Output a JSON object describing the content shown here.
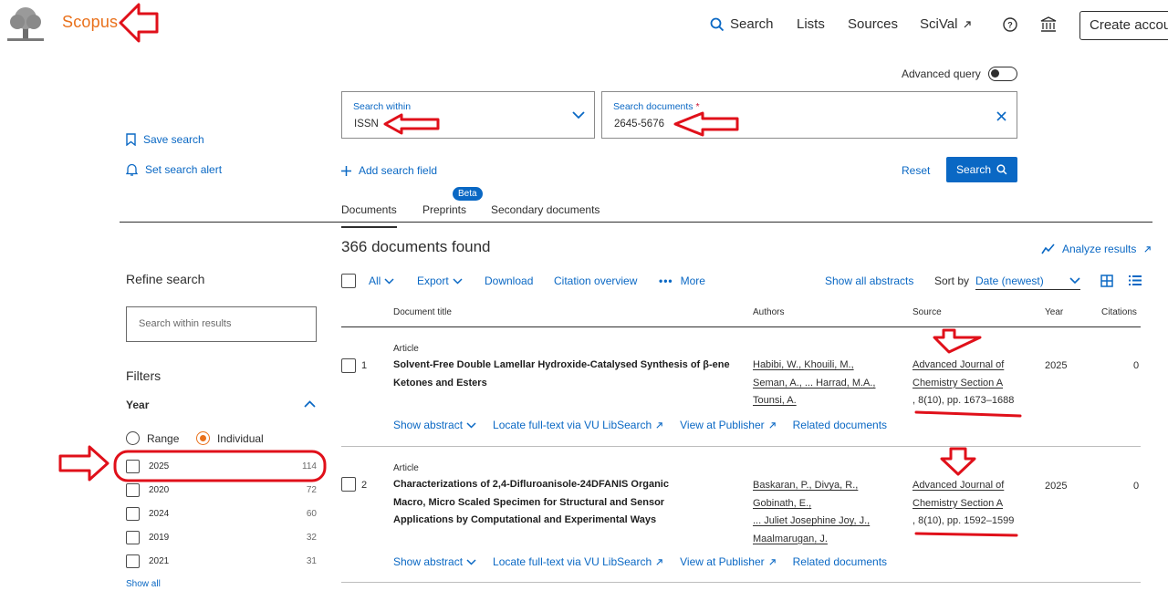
{
  "header": {
    "brand": "Scopus",
    "nav": {
      "search": "Search",
      "lists": "Lists",
      "sources": "Sources",
      "scival": "SciVal",
      "create": "Create account"
    }
  },
  "advanced_query": "Advanced query",
  "search_form": {
    "within_label": "Search within",
    "within_value": "ISSN",
    "docs_label": "Search documents",
    "docs_required": "*",
    "docs_value": "2645-5676",
    "add_field": "Add search field",
    "reset": "Reset",
    "search": "Search"
  },
  "sidebar_actions": {
    "save_search": "Save search",
    "set_alert": "Set search alert"
  },
  "tabs": {
    "documents": "Documents",
    "preprints": "Preprints",
    "beta": "Beta",
    "secondary": "Secondary documents"
  },
  "results": {
    "found": "366 documents found",
    "analyze": "Analyze results",
    "toolbar": {
      "all": "All",
      "export": "Export",
      "download": "Download",
      "citation_overview": "Citation overview",
      "more": "More",
      "show_abstracts": "Show all abstracts",
      "sort_by": "Sort by",
      "sort_value": "Date (newest)"
    },
    "columns": {
      "title": "Document title",
      "authors": "Authors",
      "source": "Source",
      "year": "Year",
      "citations": "Citations"
    },
    "rows": [
      {
        "num": "1",
        "type": "Article",
        "title": "Solvent-Free Double Lamellar Hydroxide-Catalysed Synthesis of β-ene Ketones and Esters",
        "author_lines": [
          "Habibi, W., Khouili, M.,",
          "Seman, A., ... Harrad, M.A.,",
          "Tounsi, A."
        ],
        "source_lines": [
          "Advanced Journal of",
          "Chemistry Section A",
          ", 8(10), pp. 1673–1688"
        ],
        "year": "2025",
        "citations": "0"
      },
      {
        "num": "2",
        "type": "Article",
        "title": "Characterizations of 2,4-Difluroanisole-24DFANIS Organic Macro, Micro Scaled Specimen for Structural and Sensor Applications by Computational and Experimental Ways",
        "author_lines": [
          "Baskaran, P., Divya, R.,",
          "Gobinath, E.,",
          "... Juliet Josephine Joy, J.,",
          "Maalmarugan, J."
        ],
        "source_lines": [
          "Advanced Journal of",
          "Chemistry Section A",
          ", 8(10), pp. 1592–1599"
        ],
        "year": "2025",
        "citations": "0"
      }
    ],
    "row_links": {
      "show_abstract": "Show abstract",
      "locate": "Locate full-text via VU LibSearch",
      "publisher": "View at Publisher",
      "related": "Related documents"
    }
  },
  "sidebar": {
    "refine": "Refine search",
    "search_within_placeholder": "Search within results",
    "filters": "Filters",
    "year_heading": "Year",
    "range": "Range",
    "individual": "Individual",
    "years": [
      {
        "year": "2025",
        "count": "114"
      },
      {
        "year": "2020",
        "count": "72"
      },
      {
        "year": "2024",
        "count": "60"
      },
      {
        "year": "2019",
        "count": "32"
      },
      {
        "year": "2021",
        "count": "31"
      }
    ],
    "show_all": "Show all"
  },
  "colors": {
    "brand_orange": "#e9711c",
    "link_blue": "#0a68c4",
    "annotation_red": "#e0101a"
  }
}
